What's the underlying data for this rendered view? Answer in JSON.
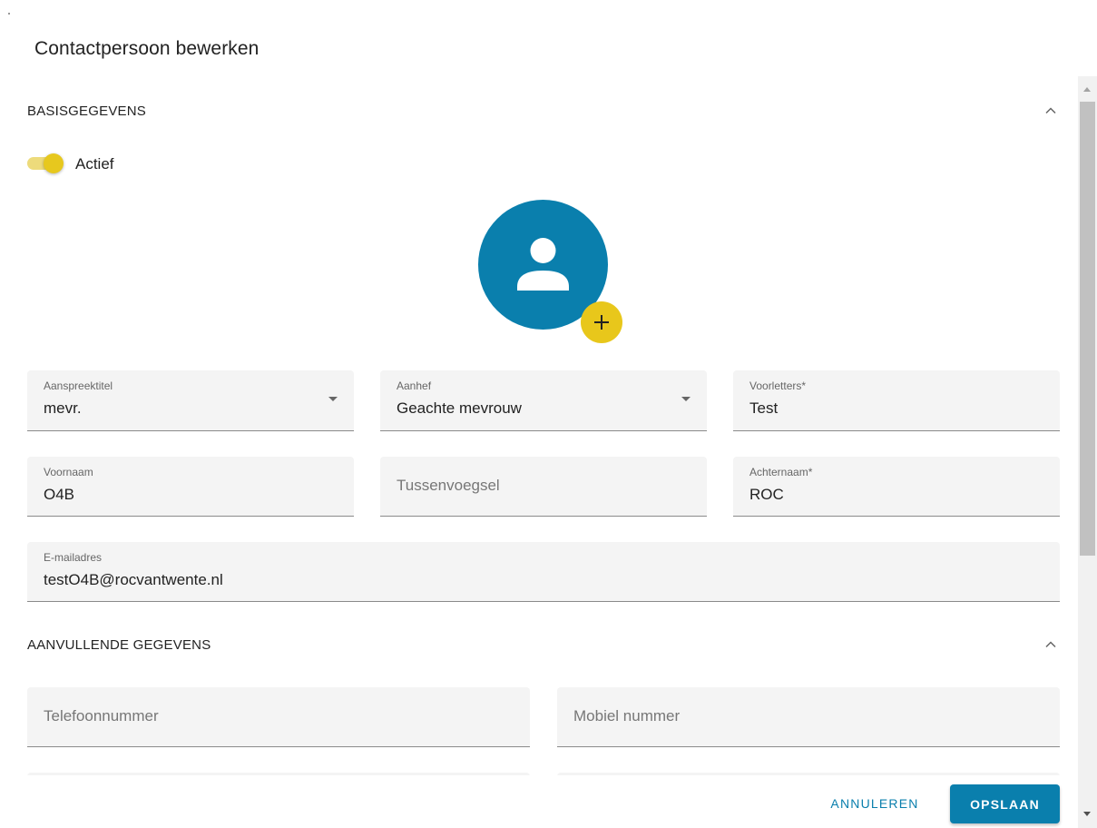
{
  "dialog": {
    "title": "Contactpersoon bewerken"
  },
  "colors": {
    "primary": "#0a7fad",
    "accent": "#e8c71b",
    "field_bg": "#f4f4f4"
  },
  "basis": {
    "title": "BASISGEGEVENS",
    "chevron_icon": "chevron-up-icon",
    "active_toggle": {
      "label": "Actief",
      "checked": true
    },
    "avatar": {
      "icon": "person-icon",
      "add_icon": "plus-icon"
    },
    "fields": {
      "aanspreektitel": {
        "label": "Aanspreektitel",
        "value": "mevr."
      },
      "aanhef": {
        "label": "Aanhef",
        "value": "Geachte mevrouw"
      },
      "voorletters": {
        "label": "Voorletters*",
        "value": "Test"
      },
      "voornaam": {
        "label": "Voornaam",
        "value": "O4B"
      },
      "tussenvoegsel": {
        "placeholder": "Tussenvoegsel",
        "value": ""
      },
      "achternaam": {
        "label": "Achternaam*",
        "value": "ROC"
      },
      "email": {
        "label": "E-mailadres",
        "value": "testO4B@rocvantwente.nl"
      }
    }
  },
  "aanvullend": {
    "title": "AANVULLENDE GEGEVENS",
    "chevron_icon": "chevron-up-icon",
    "fields": {
      "telefoon": {
        "placeholder": "Telefoonnummer",
        "value": ""
      },
      "mobiel": {
        "placeholder": "Mobiel nummer",
        "value": ""
      }
    }
  },
  "actions": {
    "cancel_label": "ANNULEREN",
    "save_label": "OPSLAAN"
  }
}
